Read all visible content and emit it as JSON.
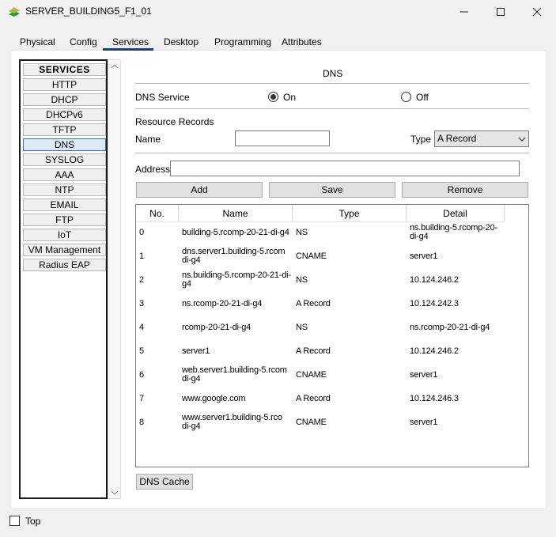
{
  "window": {
    "title": "SERVER_BUILDING5_F1_01",
    "icon": "packet-tracer-server-icon"
  },
  "tabs": [
    {
      "label": "Physical"
    },
    {
      "label": "Config"
    },
    {
      "label": "Services",
      "active": true
    },
    {
      "label": "Desktop"
    },
    {
      "label": "Programming"
    },
    {
      "label": "Attributes"
    }
  ],
  "services": {
    "header": "SERVICES",
    "items": [
      "HTTP",
      "DHCP",
      "DHCPv6",
      "TFTP",
      "DNS",
      "SYSLOG",
      "AAA",
      "NTP",
      "EMAIL",
      "FTP",
      "IoT",
      "VM Management",
      "Radius EAP"
    ],
    "selected": "DNS"
  },
  "dns": {
    "section_title": "DNS",
    "service_label": "DNS Service",
    "on_label": "On",
    "off_label": "Off",
    "service_state": "On",
    "records_label": "Resource Records",
    "name_label": "Name",
    "name_value": "",
    "type_label": "Type",
    "type_value": "A Record",
    "address_label": "Address",
    "address_value": "",
    "add_label": "Add",
    "save_label": "Save",
    "remove_label": "Remove",
    "cache_label": "DNS Cache"
  },
  "table": {
    "headers": [
      "No.",
      "Name",
      "Type",
      "Detail"
    ],
    "rows": [
      {
        "no": "0",
        "name1": "building-5.rcomp-20-21-di-g4",
        "name2": "",
        "type": "NS",
        "detail1": "ns.building-5.rcomp-20-",
        "detail2": "di-g4"
      },
      {
        "no": "1",
        "name1": "dns.server1.building-5.rcom",
        "name2": "di-g4",
        "type": "CNAME",
        "detail1": "server1",
        "detail2": ""
      },
      {
        "no": "2",
        "name1": "ns.building-5.rcomp-20-21-di-",
        "name2": "g4",
        "type": "NS",
        "detail1": "10.124.246.2",
        "detail2": ""
      },
      {
        "no": "3",
        "name1": "ns.rcomp-20-21-di-g4",
        "name2": "",
        "type": "A Record",
        "detail1": "10.124.242.3",
        "detail2": ""
      },
      {
        "no": "4",
        "name1": "rcomp-20-21-di-g4",
        "name2": "",
        "type": "NS",
        "detail1": "ns.rcomp-20-21-di-g4",
        "detail2": ""
      },
      {
        "no": "5",
        "name1": "server1",
        "name2": "",
        "type": "A Record",
        "detail1": "10.124.246.2",
        "detail2": ""
      },
      {
        "no": "6",
        "name1": "web.server1.building-5.rcom",
        "name2": "di-g4",
        "type": "CNAME",
        "detail1": "server1",
        "detail2": ""
      },
      {
        "no": "7",
        "name1": "www.google.com",
        "name2": "",
        "type": "A Record",
        "detail1": "10.124.246.3",
        "detail2": ""
      },
      {
        "no": "8",
        "name1": "www.server1.building-5.rco",
        "name2": "di-g4",
        "type": "CNAME",
        "detail1": "server1",
        "detail2": ""
      }
    ]
  },
  "footer": {
    "top_label": "Top",
    "top_checked": false
  }
}
